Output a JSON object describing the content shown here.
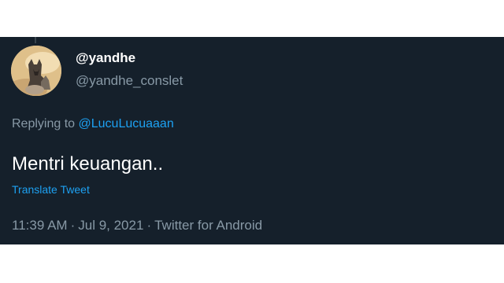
{
  "tweet": {
    "display_name": "@yandhe",
    "username": "@yandhe_conslet",
    "replying_prefix": "Replying to",
    "replying_to": "@LucuLucuaaan",
    "text": "Mentri keuangan..",
    "translate_label": "Translate Tweet",
    "time": "11:39 AM",
    "date": "Jul 9, 2021",
    "source": "Twitter for Android",
    "separator": "·"
  },
  "avatar": {
    "icon": "dog-photo-icon"
  },
  "colors": {
    "background": "#15202b",
    "primary_text": "#ffffff",
    "secondary_text": "#8899a6",
    "accent": "#1da1f2"
  }
}
